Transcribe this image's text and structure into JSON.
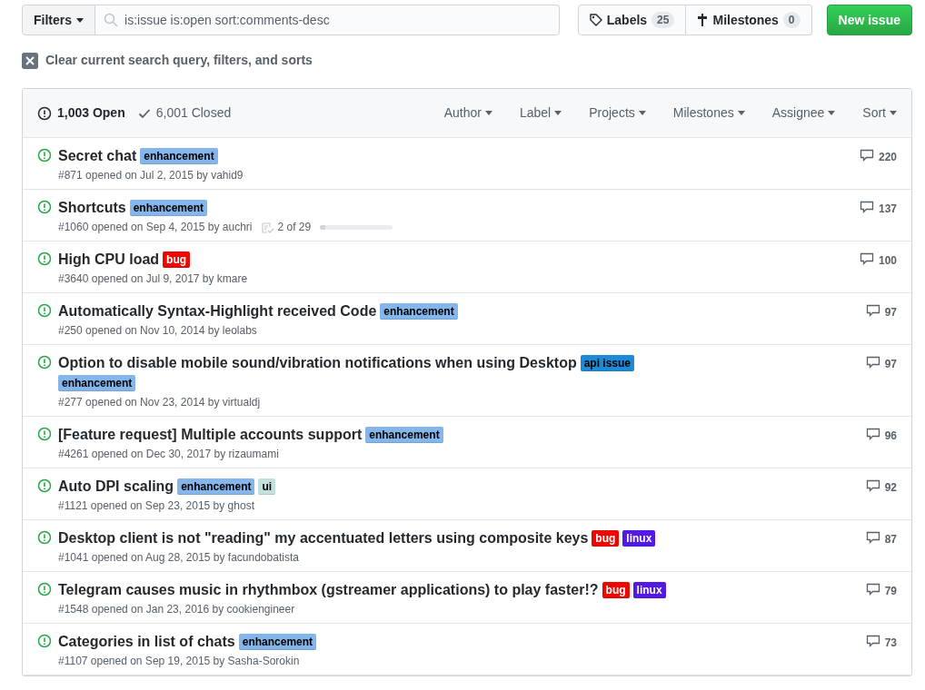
{
  "toolbar": {
    "filters_label": "Filters",
    "search": {
      "value": "is:issue is:open sort:comments-desc"
    },
    "labels": {
      "label": "Labels",
      "count": "25"
    },
    "milestones": {
      "label": "Milestones",
      "count": "0"
    },
    "new_issue": "New issue"
  },
  "clear_filters": "Clear current search query, filters, and sorts",
  "list_header": {
    "states": [
      {
        "label": "1,003 Open",
        "kind": "open",
        "selected": true
      },
      {
        "label": "6,001 Closed",
        "kind": "closed",
        "selected": false
      }
    ],
    "filters": [
      "Author",
      "Label",
      "Projects",
      "Milestones",
      "Assignee",
      "Sort"
    ]
  },
  "issues": [
    {
      "title": "Secret chat",
      "labels": [
        {
          "name": "enhancement",
          "color": "#84b6eb"
        }
      ],
      "meta": "#871 opened on Jul 2, 2015 by vahid9",
      "comments": "220"
    },
    {
      "title": "Shortcuts",
      "labels": [
        {
          "name": "enhancement",
          "color": "#84b6eb"
        }
      ],
      "meta": "#1060 opened on Sep 4, 2015 by auchri",
      "tasks": {
        "text": "2 of 29",
        "level": 0.069
      },
      "comments": "137"
    },
    {
      "title": "High CPU load",
      "labels": [
        {
          "name": "bug",
          "color": "#ee0701"
        }
      ],
      "meta": "#3640 opened on Jul 9, 2017 by kmare",
      "comments": "100"
    },
    {
      "title": "Automatically Syntax-Highlight received Code",
      "labels": [
        {
          "name": "enhancement",
          "color": "#84b6eb"
        }
      ],
      "meta": "#250 opened on Nov 10, 2014 by leolabs",
      "comments": "97"
    },
    {
      "title": "Option to disable mobile sound/vibration notifications when using Desktop",
      "labels": [
        {
          "name": "api issue",
          "color": "#1d8ad6"
        },
        {
          "name": "enhancement",
          "color": "#84b6eb"
        }
      ],
      "meta": "#277 opened on Nov 23, 2014 by virtualdj",
      "comments": "97"
    },
    {
      "title": "[Feature request] Multiple accounts support",
      "labels": [
        {
          "name": "enhancement",
          "color": "#84b6eb"
        }
      ],
      "meta": "#4261 opened on Dec 30, 2017 by rizaumami",
      "comments": "96"
    },
    {
      "title": "Auto DPI scaling",
      "labels": [
        {
          "name": "enhancement",
          "color": "#84b6eb"
        },
        {
          "name": "ui",
          "color": "#c2e0dc"
        }
      ],
      "meta": "#1121 opened on Sep 23, 2015 by ghost",
      "comments": "92"
    },
    {
      "title": "Desktop client is not \"reading\" my accentuated letters using composite keys",
      "labels": [
        {
          "name": "bug",
          "color": "#ee0701"
        },
        {
          "name": "linux",
          "color": "#5319e7"
        }
      ],
      "meta": "#1041 opened on Aug 28, 2015 by facundobatista",
      "comments": "87"
    },
    {
      "title": "Telegram causes music in rhythmbox (gstreamer applications) to play faster!?",
      "labels": [
        {
          "name": "bug",
          "color": "#ee0701"
        },
        {
          "name": "linux",
          "color": "#5319e7"
        }
      ],
      "meta": "#1548 opened on Jan 23, 2016 by cookiengineer",
      "comments": "79"
    },
    {
      "title": "Categories in list of chats",
      "labels": [
        {
          "name": "enhancement",
          "color": "#84b6eb"
        }
      ],
      "meta": "#1107 opened on Sep 19, 2015 by Sasha-Sorokin",
      "comments": "73"
    }
  ]
}
